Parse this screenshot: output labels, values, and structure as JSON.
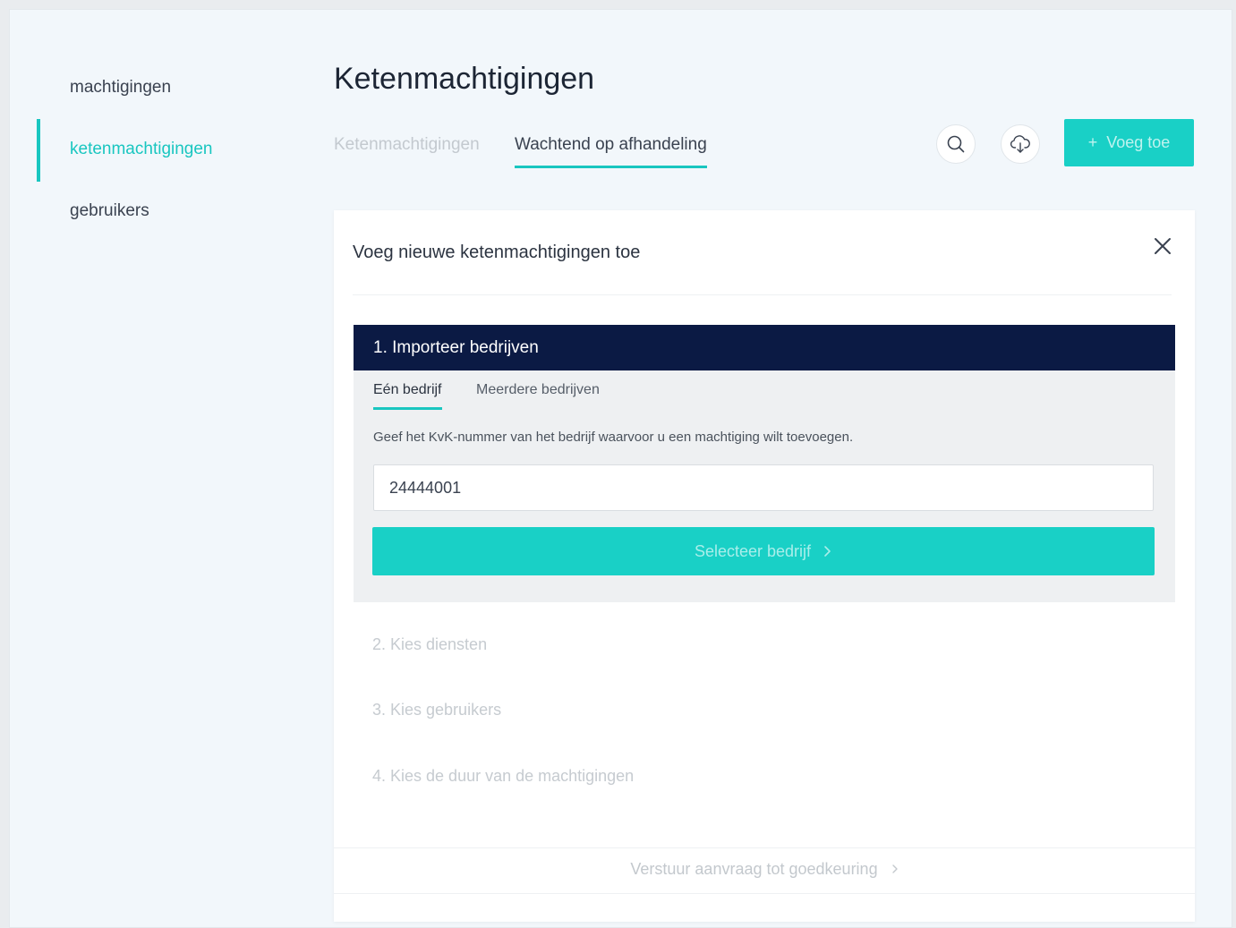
{
  "sidebar": {
    "items": [
      {
        "label": "machtigingen"
      },
      {
        "label": "ketenmachtigingen"
      },
      {
        "label": "gebruikers"
      }
    ]
  },
  "header": {
    "title": "Ketenmachtigingen",
    "tabs": [
      {
        "label": "Ketenmachtigingen"
      },
      {
        "label": "Wachtend op afhandeling"
      }
    ],
    "add_button_label": "Voeg toe",
    "add_button_icon": "plus-icon",
    "search_icon": "search-icon",
    "download_icon": "cloud-download-icon"
  },
  "card": {
    "title": "Voeg nieuwe ketenmachtigingen toe",
    "step1": {
      "title": "1. Importeer bedrijven",
      "tabs": [
        {
          "label": "Eén bedrijf"
        },
        {
          "label": "Meerdere bedrijven"
        }
      ],
      "instructions": "Geef het KvK-nummer van het bedrijf waarvoor u een machtiging wilt toevoegen.",
      "kvk_value": "24444001",
      "select_button_label": "Selecteer bedrijf"
    },
    "steps": [
      {
        "label": "2. Kies diensten"
      },
      {
        "label": "3. Kies gebruikers"
      },
      {
        "label": "4. Kies de duur van de machtigingen"
      }
    ],
    "submit_label": "Verstuur aanvraag tot goedkeuring"
  },
  "colors": {
    "accent": "#19c6c0",
    "step_header": "#0b1a44"
  }
}
